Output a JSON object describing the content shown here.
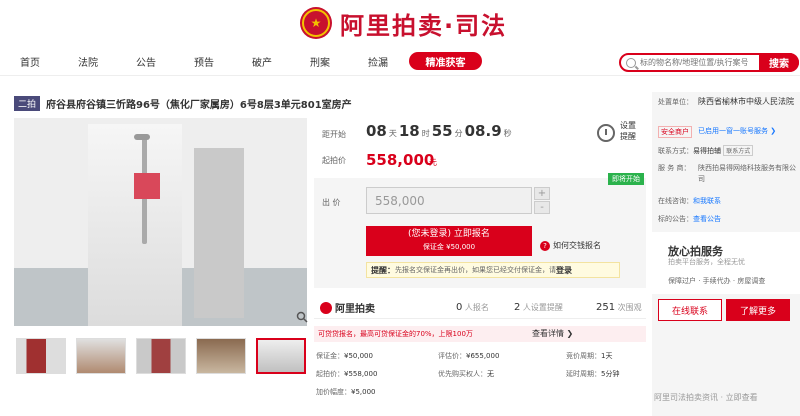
{
  "header": {
    "logo_text": "阿里拍卖·司法",
    "emblem_text": "★"
  },
  "nav": {
    "items": [
      "首页",
      "法院",
      "公告",
      "预告",
      "破产",
      "刑案",
      "捡漏"
    ],
    "hot": "精准获客"
  },
  "search": {
    "placeholder": "标的物名称/地理位置/执行案号",
    "button": "搜索"
  },
  "title": {
    "badge": "二拍",
    "text": "府谷县府谷镇三忻路96号（焦化厂家属房）6号8层3单元801室房产"
  },
  "timer": {
    "label": "距开始",
    "days": "08",
    "days_unit": "天",
    "hours": "18",
    "hours_unit": "时",
    "mins": "55",
    "mins_unit": "分",
    "secs": "08.9",
    "secs_unit": "秒",
    "remind": "设置\n提醒"
  },
  "price": {
    "label": "起拍价",
    "value": "558,000",
    "unit": "元"
  },
  "bid": {
    "status": "即将开始",
    "label": "出 价",
    "value": "558,000",
    "plus": "+",
    "minus": "-",
    "signup_line1": "(您未登录) 立即报名",
    "signup_line2": "保证金 ¥50,000",
    "howto_icon": "?",
    "howto": "如何交钱报名",
    "tip_label": "提醒：",
    "tip": "先报名交保证金再出价，如果您已经交付保证金，请",
    "tip_link": "登录"
  },
  "stats": {
    "logo": "阿里拍卖",
    "enrolled_num": "0",
    "enrolled": "人报名",
    "remind_num": "2",
    "remind": "人设置提醒",
    "views_num": "251",
    "views": "次围观"
  },
  "loan": {
    "text": "可贷贷报名，最高可贷保证金的70%，上限100万",
    "link": "查看详情 ❯"
  },
  "details": [
    {
      "k": "保证金：",
      "v": "¥50,000"
    },
    {
      "k": "评估价：",
      "v": "¥655,000"
    },
    {
      "k": "竞价周期：",
      "v": "1天"
    },
    {
      "k": "起拍价：",
      "v": "¥558,000"
    },
    {
      "k": "优先购买权人：",
      "v": "无"
    },
    {
      "k": "延时周期：",
      "v": "5分钟"
    },
    {
      "k": "加价幅度：",
      "v": "¥5,000"
    }
  ],
  "side": {
    "unit_label": "处置单位：",
    "unit": "陕西省榆林市中级人民法院",
    "safe_tag": "安全商户",
    "safe_link": "已启用一窗一账号服务 ❯",
    "contact_label": "联系方式：",
    "contact": "易得拍辅",
    "contact_chip": "联系方式",
    "service_label": "服 务 商：",
    "service": "陕西拍易得网络科技服务有限公司",
    "online_label": "在线咨询：",
    "online": "和我联系",
    "notice_label": "标的公告：",
    "notice": "查看公告",
    "rec_title": "放心拍服务",
    "rec_sub": "拍卖平台服务，全程无忧",
    "rec_tags": "保障过户 · 手续代办 · 房屋调查",
    "btn_online": "在线联系",
    "btn_more": "了解更多"
  },
  "watermark": "阿里司法拍卖资讯 · 立即查看"
}
